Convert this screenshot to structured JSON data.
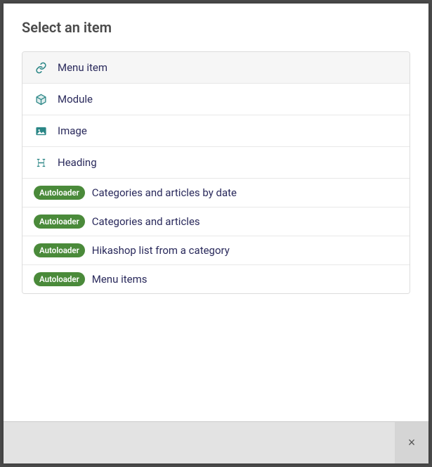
{
  "title": "Select an item",
  "badge_label": "Autoloader",
  "items": [
    {
      "label": "Menu item",
      "icon": "link",
      "badge": false,
      "selected": true
    },
    {
      "label": "Module",
      "icon": "cube",
      "badge": false,
      "selected": false
    },
    {
      "label": "Image",
      "icon": "image",
      "badge": false,
      "selected": false
    },
    {
      "label": "Heading",
      "icon": "heading",
      "badge": false,
      "selected": false
    },
    {
      "label": "Categories and articles by date",
      "icon": null,
      "badge": true,
      "selected": false
    },
    {
      "label": "Categories and articles",
      "icon": null,
      "badge": true,
      "selected": false
    },
    {
      "label": "Hikashop list from a category",
      "icon": null,
      "badge": true,
      "selected": false
    },
    {
      "label": "Menu items",
      "icon": null,
      "badge": true,
      "selected": false
    }
  ],
  "close_symbol": "×"
}
